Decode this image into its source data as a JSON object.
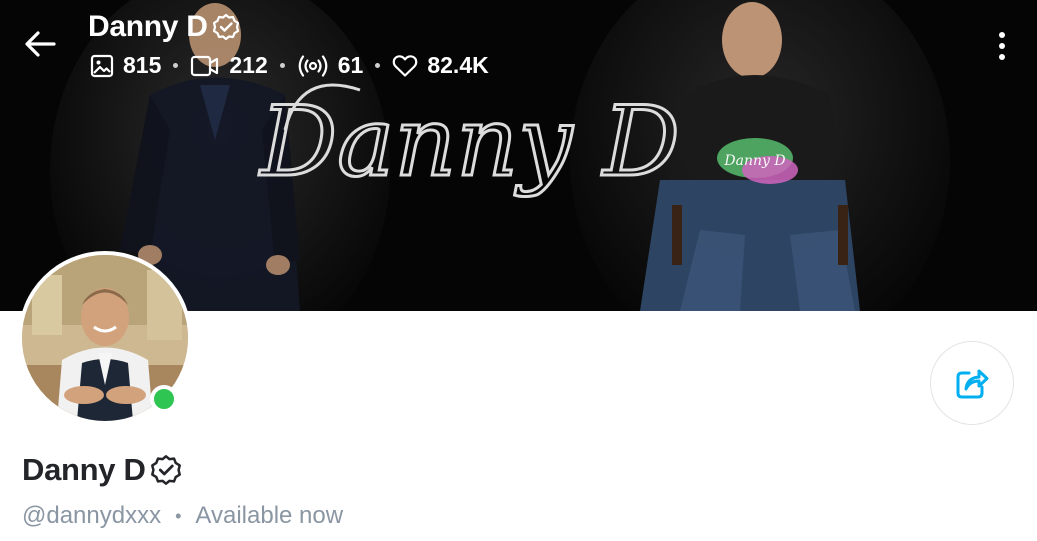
{
  "profile": {
    "display_name": "Danny D",
    "username": "@dannydxxx",
    "status": "Available now",
    "online": true
  },
  "cover": {
    "signature_text": "Danny D",
    "hoodie_text": "Danny D"
  },
  "stats": {
    "photos": "815",
    "videos": "212",
    "streams": "61",
    "likes": "82.4K"
  },
  "icons": {
    "back": "back-arrow-icon",
    "verified": "verified-badge-icon",
    "photos": "image-icon",
    "videos": "video-camera-icon",
    "streams": "broadcast-icon",
    "likes": "heart-icon",
    "more": "more-vertical-icon",
    "share": "share-icon"
  },
  "colors": {
    "accent": "#00aff0",
    "online": "#2fc553",
    "muted_text": "#8a96a3",
    "primary_text": "#242529",
    "cover_bg": "#050505"
  }
}
